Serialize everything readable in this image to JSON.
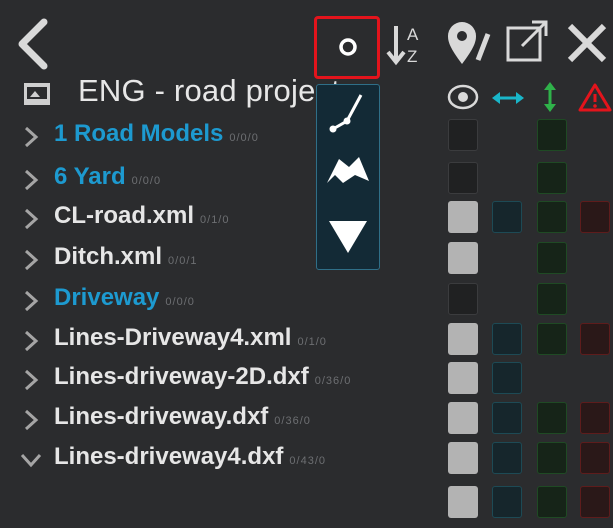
{
  "header": {
    "back_label": "back",
    "title": "ENG - road project"
  },
  "items": [
    {
      "name": "1 Road Models",
      "count": "0/0/0",
      "link": true,
      "expanded": false,
      "vis": false,
      "h": false,
      "v": true,
      "w": false
    },
    {
      "name": "6 Yard",
      "count": "0/0/0",
      "link": true,
      "expanded": false,
      "vis": false,
      "h": false,
      "v": true,
      "w": false
    },
    {
      "name": "CL-road.xml",
      "count": "0/1/0",
      "link": false,
      "expanded": false,
      "vis": true,
      "h": true,
      "v": true,
      "w": true
    },
    {
      "name": "Ditch.xml",
      "count": "0/0/1",
      "link": false,
      "expanded": false,
      "vis": true,
      "h": false,
      "v": true,
      "w": false
    },
    {
      "name": "Driveway",
      "count": "0/0/0",
      "link": true,
      "expanded": false,
      "vis": false,
      "h": false,
      "v": true,
      "w": false
    },
    {
      "name": "Lines-Driveway4.xml",
      "count": "0/1/0",
      "link": false,
      "expanded": false,
      "vis": true,
      "h": true,
      "v": true,
      "w": true
    },
    {
      "name": "Lines-driveway-2D.dxf",
      "count": "0/36/0",
      "link": false,
      "expanded": false,
      "vis": true,
      "h": true,
      "v": false,
      "w": false
    },
    {
      "name": "Lines-driveway.dxf",
      "count": "0/36/0",
      "link": false,
      "expanded": false,
      "vis": true,
      "h": true,
      "v": true,
      "w": true
    },
    {
      "name": "Lines-driveway4.dxf",
      "count": "0/43/0",
      "link": false,
      "expanded": true,
      "vis": true,
      "h": true,
      "v": true,
      "w": true
    }
  ],
  "colors": {
    "accent": "#1d9ad0",
    "h_icon": "#19b6c9",
    "v_icon": "#2fb24a",
    "warn": "#e3141c"
  }
}
